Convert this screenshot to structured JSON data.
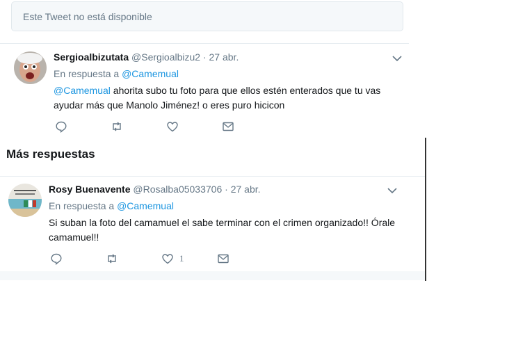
{
  "unavailable_notice": "Este Tweet no está disponible",
  "tweets": [
    {
      "name": "Sergioalbizutata",
      "handle": "@Sergioalbizu2",
      "time": "· 27 abr.",
      "reply_prefix": "En respuesta a",
      "reply_to": "@Camemual",
      "mention": "@Camemual",
      "text": " ahorita subo tu foto para que ellos estén enterados que tu vas ayudar más que Manolo Jiménez! o eres puro hicicon",
      "like_count": ""
    },
    {
      "name": "Rosy Buenavente",
      "handle": "@Rosalba05033706",
      "time": "· 27 abr.",
      "reply_prefix": "En respuesta a",
      "reply_to": "@Camemual",
      "mention": "",
      "text": "Si suban la foto del camamuel el sabe terminar con el crimen organizado!! Órale camamuel!!",
      "like_count": "1"
    }
  ],
  "more_replies_title": "Más respuestas",
  "icons": [
    "reply-icon",
    "retweet-icon",
    "like-icon",
    "dm-icon",
    "chevron-down-icon"
  ],
  "colors": {
    "link": "#1b95e0",
    "muted": "#657786",
    "text": "#14171a"
  }
}
